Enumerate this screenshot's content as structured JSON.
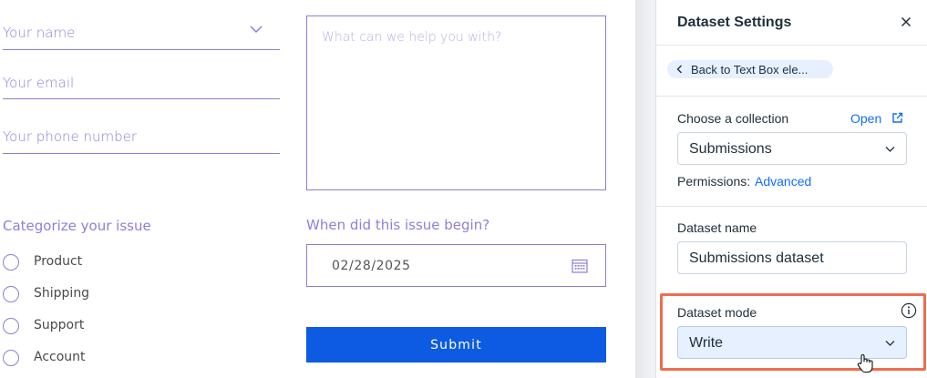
{
  "form": {
    "name_placeholder": "Your name",
    "email_placeholder": "Your email",
    "phone_placeholder": "Your phone number",
    "message_placeholder": "What can we help you with?",
    "issue_category_title": "Categorize your issue",
    "issue_options": [
      "Product",
      "Shipping",
      "Support",
      "Account"
    ],
    "date_title": "When did this issue begin?",
    "date_value": "02/28/2025",
    "submit_label": "Submit"
  },
  "panel": {
    "title": "Dataset Settings",
    "back_label": "Back to Text Box ele...",
    "collection_label": "Choose a collection",
    "open_link": "Open",
    "collection_value": "Submissions",
    "permissions_label": "Permissions:",
    "permissions_value": "Advanced",
    "dataset_name_label": "Dataset name",
    "dataset_name_value": "Submissions dataset",
    "dataset_mode_label": "Dataset mode",
    "dataset_mode_value": "Write"
  },
  "colors": {
    "form_accent": "#8b7fd6",
    "submit_button": "#0d5be3",
    "link": "#116dff",
    "highlight": "#ef6d50"
  }
}
